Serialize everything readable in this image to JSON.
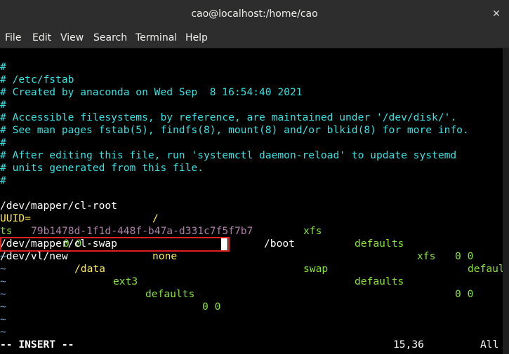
{
  "window": {
    "title": "cao@localhost:/home/cao",
    "close_icon": "close-icon"
  },
  "menubar": {
    "file": "File",
    "edit": "Edit",
    "view": "View",
    "search": "Search",
    "terminal": "Terminal",
    "help": "Help"
  },
  "fstab": {
    "comment_1": "#",
    "comment_2": "# /etc/fstab",
    "comment_3": "# Created by anaconda on Wed Sep  8 16:54:40 2021",
    "comment_4": "#",
    "comment_5": "# Accessible filesystems, by reference, are maintained under '/dev/disk/'.",
    "comment_6": "# See man pages fstab(5), findfs(8), mount(8) and/or blkid(8) for more info.",
    "comment_7": "#",
    "comment_8": "# After editing this file, run 'systemctl daemon-reload' to update systemd",
    "comment_9": "# units generated from this file.",
    "comment_10": "#",
    "root": {
      "device": "/dev/mapper/cl-root",
      "mount": "/",
      "type": "xfs",
      "options": "defaults",
      "dump_pass": "0 0"
    },
    "boot": {
      "uuid_key": "UUID=",
      "uuid_value": "79b1478d-1f1d-448f-b47a-d331c7f5f7b7",
      "mount": "/boot",
      "type": "xfs",
      "options_start": "defaul",
      "options_end": "ts",
      "dump_pass": "0 0"
    },
    "swap": {
      "device": "/dev/mapper/cl-swap",
      "mount": "none",
      "type": "swap",
      "options": "defaults",
      "dump_pass": "0 0"
    },
    "new": {
      "device": "/dev/vl/new",
      "mount": "/data",
      "type": "ext3",
      "options": "defaults",
      "dump_pass": "0 0"
    }
  },
  "statusline": {
    "mode": "-- INSERT --",
    "position": "15,36",
    "scroll": "All"
  },
  "empty_line_marker": "~"
}
